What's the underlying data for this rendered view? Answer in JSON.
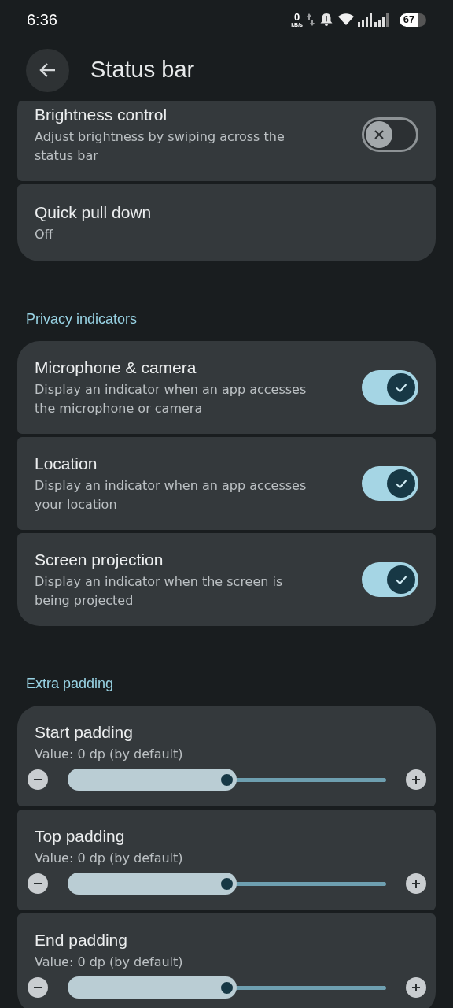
{
  "status_bar": {
    "time": "6:36",
    "net_speed_value": "0",
    "net_speed_unit": "kB/s",
    "battery": "67"
  },
  "header": {
    "title": "Status bar"
  },
  "sections": [
    {
      "items": [
        {
          "kind": "switch",
          "title": "Brightness control",
          "summary": "Adjust brightness by swiping across the status bar",
          "on": false
        },
        {
          "kind": "text",
          "title": "Quick pull down",
          "summary": "Off"
        }
      ]
    },
    {
      "title": "Privacy indicators",
      "items": [
        {
          "kind": "switch",
          "title": "Microphone & camera",
          "summary": "Display an indicator when an app accesses the microphone or camera",
          "on": true
        },
        {
          "kind": "switch",
          "title": "Location",
          "summary": "Display an indicator when an app accesses your location",
          "on": true
        },
        {
          "kind": "switch",
          "title": "Screen projection",
          "summary": "Display an indicator when the screen is being projected",
          "on": true
        }
      ]
    },
    {
      "title": "Extra padding",
      "items": [
        {
          "kind": "slider",
          "title": "Start padding",
          "summary": "Value: 0 dp (by default)",
          "level": 0.5
        },
        {
          "kind": "slider",
          "title": "Top padding",
          "summary": "Value: 0 dp (by default)",
          "level": 0.5
        },
        {
          "kind": "slider",
          "title": "End padding",
          "summary": "Value: 0 dp (by default)",
          "level": 0.5
        }
      ]
    }
  ]
}
